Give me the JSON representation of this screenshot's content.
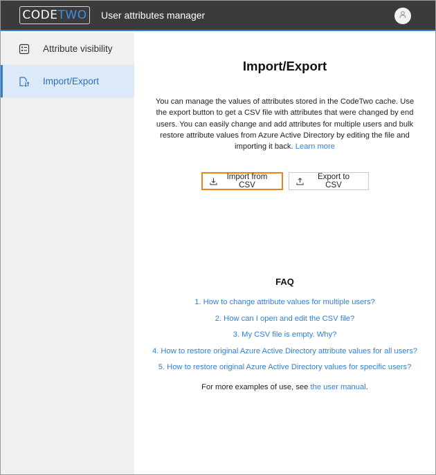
{
  "header": {
    "logo_code": "CODE",
    "logo_two": "TWO",
    "app_title": "User attributes manager"
  },
  "sidebar": {
    "items": [
      {
        "label": "Attribute visibility",
        "icon": "list-icon",
        "active": false
      },
      {
        "label": "Import/Export",
        "icon": "import-export-icon",
        "active": true
      }
    ]
  },
  "main": {
    "title": "Import/Export",
    "description": "You can manage the values of attributes stored in the CodeTwo cache. Use the export button to get a CSV file with attributes that were changed by end users. You can easily change and add attributes for multiple users and bulk restore attribute values from Azure Active Directory by editing the file and importing it back.",
    "learn_more": "Learn more",
    "import_button": "Import from CSV",
    "export_button": "Export to CSV",
    "faq_title": "FAQ",
    "faq": [
      "1. How to change attribute values for multiple users?",
      "2. How can I open and edit the CSV file?",
      "3. My CSV file is empty. Why?",
      "4. How to restore original Azure Active Directory attribute values for all users?",
      "5. How to restore original Azure Active Directory values for specific users?"
    ],
    "more_prefix": "For more examples of use, see",
    "more_link": "the user manual",
    "more_suffix": "."
  },
  "colors": {
    "accent": "#2f7fd8",
    "header_bg": "#3b3b3b",
    "highlight_border": "#e8821a",
    "active_nav_bg": "#dbe9f9"
  }
}
